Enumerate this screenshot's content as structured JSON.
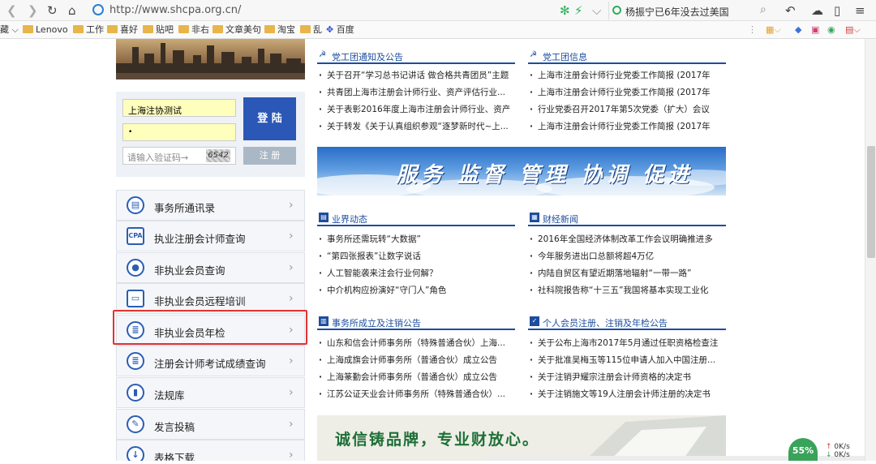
{
  "toolbar": {
    "url": "http://www.shcpa.org.cn/",
    "search_text": "杨振宁已6年没去过美国",
    "icons": [
      "back-icon",
      "forward-icon",
      "reload-icon",
      "home-icon",
      "url-shield-icon",
      "lightning-icon",
      "chevron-down-icon",
      "search-icon",
      "undo-icon",
      "cloud-icon",
      "mobile-icon",
      "menu-icon"
    ]
  },
  "bookmarks": [
    "藏",
    "Lenovo",
    "工作",
    "喜好",
    "贴吧",
    "非右",
    "文章美句",
    "淘宝",
    "乱",
    "百度"
  ],
  "login": {
    "username": "上海注协测试",
    "password": "•",
    "captcha_placeholder": "请输入验证码→",
    "captcha_code": "6542",
    "login_label": "登 陆",
    "register_label": "注 册"
  },
  "menu": [
    {
      "label": "事务所通讯录",
      "icon": "address-book-icon"
    },
    {
      "label": "执业注册会计师查询",
      "icon": "cpa-icon"
    },
    {
      "label": "非执业会员查询",
      "icon": "user-icon"
    },
    {
      "label": "非执业会员远程培训",
      "icon": "monitor-icon"
    },
    {
      "label": "非执业会员年检",
      "icon": "document-icon"
    },
    {
      "label": "注册会计师考试成绩查询",
      "icon": "score-icon"
    },
    {
      "label": "法规库",
      "icon": "book-icon"
    },
    {
      "label": "发言投稿",
      "icon": "pen-icon"
    },
    {
      "label": "表格下载",
      "icon": "download-icon"
    }
  ],
  "sections": {
    "party_notice": {
      "title": "党工团通知及公告",
      "items": [
        "关于召开“学习总书记讲话 做合格共青团员”主题",
        "共青团上海市注册会计师行业、资产评估行业...",
        "关于表彰2016年度上海市注册会计师行业、资产",
        "关于转发《关于认真组织参观“逐梦新时代~上..."
      ]
    },
    "party_info": {
      "title": "党工团信息",
      "items": [
        "上海市注册会计师行业党委工作简报 (2017年",
        "上海市注册会计师行业党委工作简报 (2017年",
        "行业党委召开2017年第5次党委（扩大）会议",
        "上海市注册会计师行业党委工作简报 (2017年"
      ]
    },
    "industry": {
      "title": "业界动态",
      "items": [
        "事务所还需玩转“大数据”",
        "“第四张报表”让数字说话",
        "人工智能袭来注会行业何解？",
        "中介机构应扮演好“守门人”角色"
      ]
    },
    "finance": {
      "title": "财经新闻",
      "items": [
        "2016年全国经济体制改革工作会议明确推进多",
        "今年服务进出口总额将超4万亿",
        "内陆自贸区有望近期落地辐射“一带一路”",
        "社科院报告称“十三五”我国将基本实现工业化"
      ]
    },
    "firm_notice": {
      "title": "事务所成立及注销公告",
      "items": [
        "山东和信会计师事务所（特殊普通合伙）上海...",
        "上海成旗会计师事务所（普通合伙）成立公告",
        "上海篆勤会计师事务所（普通合伙）成立公告",
        "江苏公证天业会计师事务所（特殊普通合伙）..."
      ]
    },
    "member_notice": {
      "title": "个人会员注册、注销及年检公告",
      "items": [
        "关于公布上海市2017年5月通过任职资格检查注",
        "关于批准吴梅玉等115位申请人加入中国注册...",
        "关于注销尹耀宗注册会计师资格的决定书",
        "关于注销施文等19人注册会计师注册的决定书"
      ]
    }
  },
  "banners": {
    "service": "服务 监督 管理 协调 促进",
    "slogan": "诚信铸品牌，专业财放心。"
  },
  "status": {
    "speed_percent": "55%",
    "net_up": "0K/s",
    "net_down": "0K/s"
  }
}
